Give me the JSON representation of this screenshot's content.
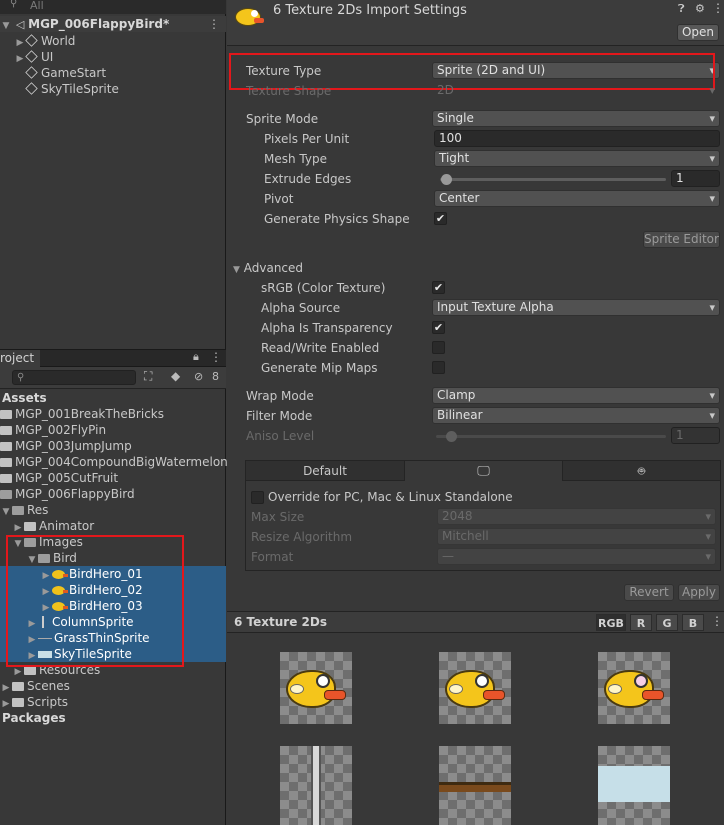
{
  "hierarchy": {
    "search_placeholder": "All",
    "scene_name": "MGP_006FlappyBird*",
    "items": [
      {
        "label": "World"
      },
      {
        "label": "UI"
      },
      {
        "label": "GameStart"
      },
      {
        "label": "SkyTileSprite"
      }
    ]
  },
  "project": {
    "tab_label": "roject",
    "hidden_count": "8",
    "tree": {
      "assets": "Assets",
      "folders": [
        "MGP_001BreakTheBricks",
        "MGP_002FlyPin",
        "MGP_003JumpJump",
        "MGP_004CompoundBigWatermelon",
        "MGP_005CutFruit",
        "MGP_006FlappyBird"
      ],
      "res": "Res",
      "animator": "Animator",
      "images": "Images",
      "bird": "Bird",
      "bird_heroes": [
        "BirdHero_01",
        "BirdHero_02",
        "BirdHero_03"
      ],
      "sprites": [
        "ColumnSprite",
        "GrassThinSprite",
        "SkyTileSprite"
      ],
      "resources": "Resources",
      "scenes": "Scenes",
      "scripts": "Scripts",
      "packages": "Packages"
    }
  },
  "inspector": {
    "title": "6 Texture 2Ds Import Settings",
    "open_button": "Open",
    "texture_type": {
      "label": "Texture Type",
      "value": "Sprite (2D and UI)"
    },
    "texture_shape": {
      "label": "Texture Shape",
      "value": "2D"
    },
    "sprite_mode": {
      "label": "Sprite Mode",
      "value": "Single"
    },
    "pixels_per_unit": {
      "label": "Pixels Per Unit",
      "value": "100"
    },
    "mesh_type": {
      "label": "Mesh Type",
      "value": "Tight"
    },
    "extrude_edges": {
      "label": "Extrude Edges",
      "value": "1",
      "level": 0.0
    },
    "pivot": {
      "label": "Pivot",
      "value": "Center"
    },
    "generate_physics": {
      "label": "Generate Physics Shape",
      "checked": true
    },
    "sprite_editor_button": "Sprite Editor",
    "advanced": {
      "label": "Advanced",
      "srgb": {
        "label": "sRGB (Color Texture)",
        "checked": true
      },
      "alpha_source": {
        "label": "Alpha Source",
        "value": "Input Texture Alpha"
      },
      "alpha_transparency": {
        "label": "Alpha Is Transparency",
        "checked": true
      },
      "read_write": {
        "label": "Read/Write Enabled",
        "checked": false
      },
      "mip_maps": {
        "label": "Generate Mip Maps",
        "checked": false
      }
    },
    "wrap_mode": {
      "label": "Wrap Mode",
      "value": "Clamp"
    },
    "filter_mode": {
      "label": "Filter Mode",
      "value": "Bilinear"
    },
    "aniso_level": {
      "label": "Aniso Level",
      "value": "1",
      "level": 0.0
    },
    "platform_tabs": {
      "default": "Default"
    },
    "override": {
      "label": "Override for PC, Mac & Linux Standalone",
      "checked": false
    },
    "max_size": {
      "label": "Max Size",
      "value": "2048"
    },
    "resize_algorithm": {
      "label": "Resize Algorithm",
      "value": "Mitchell"
    },
    "format": {
      "label": "Format",
      "value": "—"
    },
    "revert_button": "Revert",
    "apply_button": "Apply"
  },
  "preview": {
    "title": "6 Texture 2Ds",
    "channels": [
      "RGB",
      "R",
      "G",
      "B"
    ]
  },
  "colors": {
    "selection": "#2c5d87",
    "annotation_red": "#e3171b",
    "bird_yellow": "#f4c51b"
  }
}
